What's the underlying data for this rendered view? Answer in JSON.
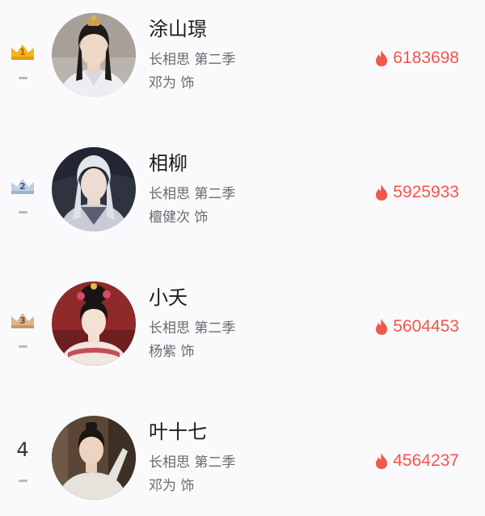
{
  "colors": {
    "heat": "#f2564c",
    "gold_crown": "#f5b418",
    "silver_crown": "#9db4ce",
    "bronze_crown": "#c9976d",
    "trend_dash": "#b8b8bc"
  },
  "rankings": [
    {
      "rank": "1",
      "rank_badge": "gold-crown-icon",
      "trend": "unchanged",
      "name": "涂山璟",
      "show": "长相思 第二季",
      "actor": "邓为 饰",
      "heat_icon": "flame-icon",
      "heat": "6183698"
    },
    {
      "rank": "2",
      "rank_badge": "silver-crown-icon",
      "trend": "unchanged",
      "name": "相柳",
      "show": "长相思 第二季",
      "actor": "檀健次 饰",
      "heat_icon": "flame-icon",
      "heat": "5925933"
    },
    {
      "rank": "3",
      "rank_badge": "bronze-crown-icon",
      "trend": "unchanged",
      "name": "小夭",
      "show": "长相思 第二季",
      "actor": "杨紫 饰",
      "heat_icon": "flame-icon",
      "heat": "5604453"
    },
    {
      "rank": "4",
      "rank_badge": "",
      "trend": "unchanged",
      "name": "叶十七",
      "show": "长相思 第二季",
      "actor": "邓为 饰",
      "heat_icon": "flame-icon",
      "heat": "4564237"
    }
  ]
}
